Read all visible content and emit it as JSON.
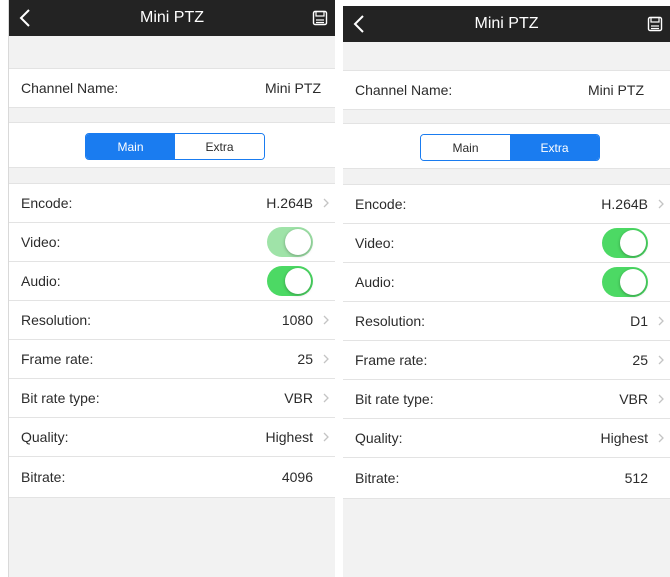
{
  "panels": [
    {
      "nav": {
        "title": "Mini PTZ",
        "back_icon": "chevron-left-icon",
        "save_icon": "save-icon"
      },
      "channel": {
        "label": "Channel Name:",
        "value": "Mini PTZ"
      },
      "segment": {
        "options": [
          "Main",
          "Extra"
        ],
        "selected": "Main"
      },
      "settings": {
        "encode": {
          "label": "Encode:",
          "value": "H.264B"
        },
        "video": {
          "label": "Video:",
          "on": true,
          "dimmed": true
        },
        "audio": {
          "label": "Audio:",
          "on": true
        },
        "resolution": {
          "label": "Resolution:",
          "value": "1080"
        },
        "frame_rate": {
          "label": "Frame rate:",
          "value": "25"
        },
        "bit_rate_type": {
          "label": "Bit rate type:",
          "value": "VBR"
        },
        "quality": {
          "label": "Quality:",
          "value": "Highest"
        },
        "bitrate": {
          "label": "Bitrate:",
          "value": "4096"
        }
      }
    },
    {
      "nav": {
        "title": "Mini PTZ",
        "back_icon": "chevron-left-icon",
        "save_icon": "save-icon"
      },
      "channel": {
        "label": "Channel Name:",
        "value": "Mini PTZ"
      },
      "segment": {
        "options": [
          "Main",
          "Extra"
        ],
        "selected": "Extra"
      },
      "settings": {
        "encode": {
          "label": "Encode:",
          "value": "H.264B"
        },
        "video": {
          "label": "Video:",
          "on": true,
          "dimmed": false
        },
        "audio": {
          "label": "Audio:",
          "on": true
        },
        "resolution": {
          "label": "Resolution:",
          "value": "D1"
        },
        "frame_rate": {
          "label": "Frame rate:",
          "value": "25"
        },
        "bit_rate_type": {
          "label": "Bit rate type:",
          "value": "VBR"
        },
        "quality": {
          "label": "Quality:",
          "value": "Highest"
        },
        "bitrate": {
          "label": "Bitrate:",
          "value": "512"
        }
      }
    }
  ],
  "colors": {
    "navbar": "#232323",
    "accent": "#1a7cf0",
    "toggle_on": "#4cd964",
    "toggle_dim": "#9fe3a8",
    "background": "#f2f2f2"
  }
}
